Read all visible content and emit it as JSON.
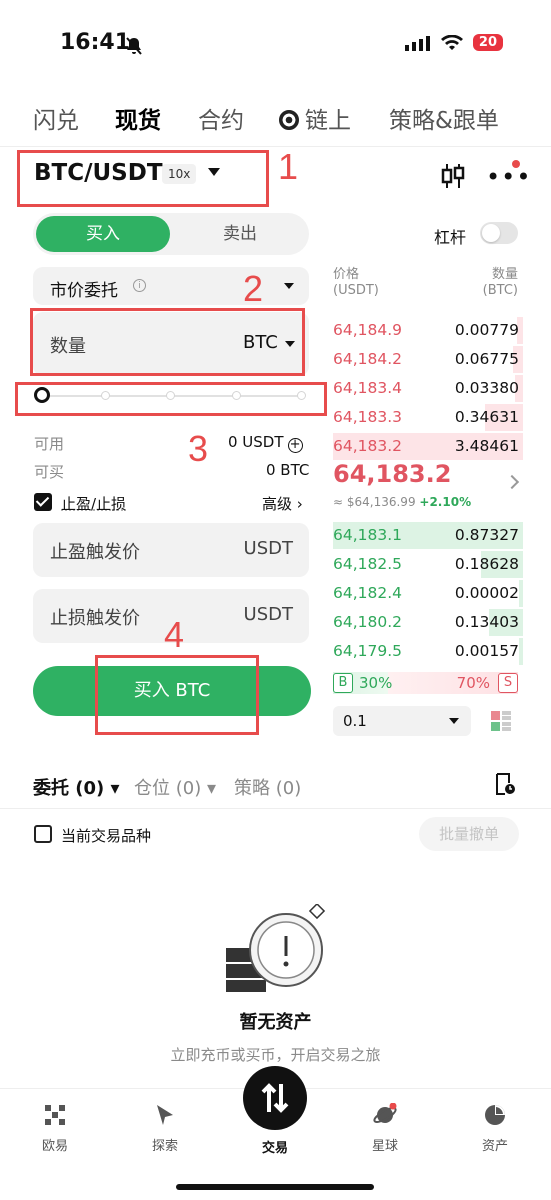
{
  "status_bar": {
    "time": "16:41",
    "battery": "20"
  },
  "top_tabs": [
    "闪兑",
    "现货",
    "合约",
    "链上",
    "策略&跟单"
  ],
  "pair": {
    "name": "BTC/USDT",
    "leverage": "10x"
  },
  "trade_side": {
    "buy": "买入",
    "sell": "卖出"
  },
  "leverage_toggle_label": "杠杆",
  "order_type": "市价委托",
  "quantity": {
    "label": "数量",
    "unit": "BTC"
  },
  "slider": {
    "percent": 0
  },
  "available": {
    "label": "可用",
    "value": "0 USDT"
  },
  "can_buy": {
    "label": "可买",
    "value": "0 BTC"
  },
  "tpsl": {
    "label": "止盈/止损",
    "checked": true,
    "advanced": "高级 ›"
  },
  "take_profit": {
    "label": "止盈触发价",
    "unit": "USDT"
  },
  "stop_loss": {
    "label": "止损触发价",
    "unit": "USDT"
  },
  "buy_button": "买入 BTC",
  "annotations": [
    "1",
    "2",
    "3",
    "4"
  ],
  "orderbook": {
    "header_price": "价格",
    "header_price_unit": "(USDT)",
    "header_amount": "数量",
    "header_amount_unit": "(BTC)",
    "asks": [
      {
        "price": "64,184.9",
        "amount": "0.00779",
        "depth": 0.03
      },
      {
        "price": "64,184.2",
        "amount": "0.06775",
        "depth": 0.05
      },
      {
        "price": "64,183.4",
        "amount": "0.03380",
        "depth": 0.04
      },
      {
        "price": "64,183.3",
        "amount": "0.34631",
        "depth": 0.2
      },
      {
        "price": "64,183.2",
        "amount": "3.48461",
        "depth": 1.0
      }
    ],
    "last_price": "64,183.2",
    "last_sub": "≈ $64,136.99",
    "last_change": "+2.10%",
    "bids": [
      {
        "price": "64,183.1",
        "amount": "0.87327",
        "depth": 1.0
      },
      {
        "price": "64,182.5",
        "amount": "0.18628",
        "depth": 0.22
      },
      {
        "price": "64,182.4",
        "amount": "0.00002",
        "depth": 0.02
      },
      {
        "price": "64,180.2",
        "amount": "0.13403",
        "depth": 0.18
      },
      {
        "price": "64,179.5",
        "amount": "0.00157",
        "depth": 0.02
      }
    ],
    "buy_ratio": "30%",
    "sell_ratio": "70%",
    "buy_ratio_value": 30,
    "buy_marker": "B",
    "sell_marker": "S",
    "depth_step": "0.1"
  },
  "order_tabs": [
    "委托 (0)",
    "仓位 (0)",
    "策略 (0)"
  ],
  "current_pair_filter": "当前交易品种",
  "batch_cancel": "批量撤单",
  "empty_state": {
    "title": "暂无资产",
    "subtitle": "立即充币或买币，开启交易之旅"
  },
  "tabbar": [
    "欧易",
    "探索",
    "交易",
    "星球",
    "资产"
  ],
  "colors": {
    "buy": "#2fb163",
    "sell": "#e05561",
    "annotation": "#e74c4c"
  }
}
